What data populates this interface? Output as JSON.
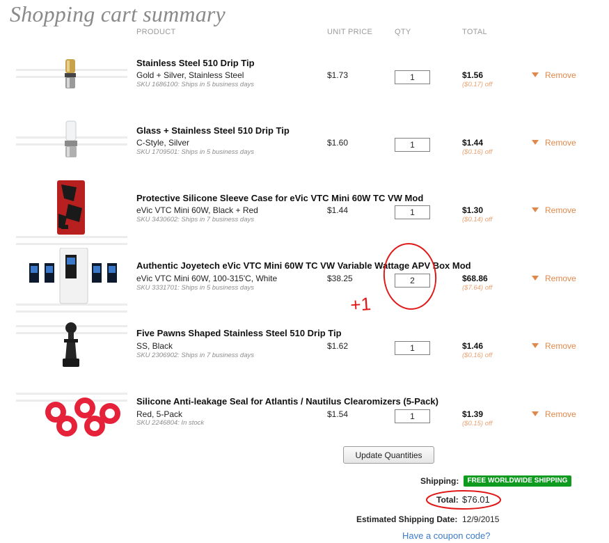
{
  "page": {
    "title": "Shopping cart summary"
  },
  "columns": {
    "product": "PRODUCT",
    "unit_price": "UNIT PRICE",
    "qty": "QTY",
    "total": "TOTAL"
  },
  "items": [
    {
      "name": "Stainless Steel 510 Drip Tip",
      "variant": "Gold + Silver, Stainless Steel",
      "sku": "SKU 1686100: Ships in 5 business days",
      "unit_price": "$1.73",
      "qty": "1",
      "total": "$1.56",
      "discount": "($0.17) off",
      "remove": "Remove"
    },
    {
      "name": "Glass + Stainless Steel 510 Drip Tip",
      "variant": "C-Style, Silver",
      "sku": "SKU 1709501: Ships in 5 business days",
      "unit_price": "$1.60",
      "qty": "1",
      "total": "$1.44",
      "discount": "($0.16) off",
      "remove": "Remove"
    },
    {
      "name": "Protective Silicone Sleeve Case for eVic VTC Mini 60W TC VW Mod",
      "variant": "eVic VTC Mini 60W, Black + Red",
      "sku": "SKU 3430602: Ships in 7 business days",
      "unit_price": "$1.44",
      "qty": "1",
      "total": "$1.30",
      "discount": "($0.14) off",
      "remove": "Remove"
    },
    {
      "name": "Authentic Joyetech eVic VTC Mini 60W TC VW Variable Wattage APV Box Mod",
      "variant": "eVic VTC Mini 60W, 100-315'C, White",
      "sku": "SKU 3331701: Ships in 5 business days",
      "unit_price": "$38.25",
      "qty": "2",
      "total": "$68.86",
      "discount": "($7.64) off",
      "remove": "Remove"
    },
    {
      "name": "Five Pawns Shaped Stainless Steel 510 Drip Tip",
      "variant": "SS, Black",
      "sku": "SKU 2306902: Ships in 7 business days",
      "unit_price": "$1.62",
      "qty": "1",
      "total": "$1.46",
      "discount": "($0.16) off",
      "remove": "Remove"
    },
    {
      "name": "Silicone Anti-leakage Seal for Atlantis / Nautilus Clearomizers (5-Pack)",
      "variant": "Red, 5-Pack",
      "sku": "SKU 2246804: In stock",
      "unit_price": "$1.54",
      "qty": "1",
      "total": "$1.39",
      "discount": "($0.15) off",
      "remove": "Remove"
    }
  ],
  "actions": {
    "update_label": "Update Quantities"
  },
  "summary": {
    "shipping_label": "Shipping:",
    "shipping_badge": "FREE WORLDWIDE SHIPPING",
    "total_label": "Total:",
    "total_value": "$76.01",
    "est_label": "Estimated Shipping Date:",
    "est_value": "12/9/2015",
    "coupon_link": "Have a coupon code?"
  },
  "annotation": {
    "note": "+1"
  },
  "colors": {
    "remove": "#e0884a",
    "discount": "#e8a070",
    "badge": "#0f9a20",
    "link": "#3a7bc8",
    "annotation": "#e01818"
  },
  "icons": {
    "remove": "triangle-down-icon"
  }
}
